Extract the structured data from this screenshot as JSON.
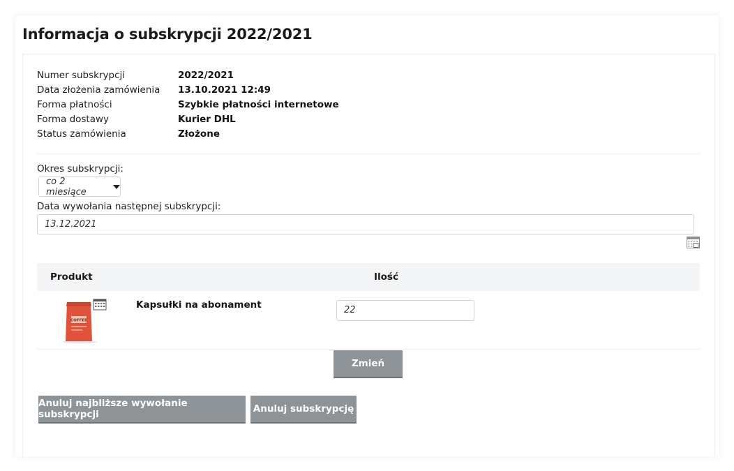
{
  "page": {
    "title": "Informacja o subskrypcji 2022/2021"
  },
  "info": {
    "rows": [
      {
        "label": "Numer subskrypcji",
        "value": "2022/2021"
      },
      {
        "label": "Data złożenia zamówienia",
        "value": "13.10.2021 12:49"
      },
      {
        "label": "Forma płatności",
        "value": "Szybkie płatności internetowe"
      },
      {
        "label": "Forma dostawy",
        "value": "Kurier DHL"
      },
      {
        "label": "Status zamówienia",
        "value": "Złożone"
      }
    ]
  },
  "period": {
    "label": "Okres subskrypcji:",
    "selected": "co 2 miesiące"
  },
  "next_date": {
    "label": "Data wywołania następnej subskrypcji:",
    "value": "13.12.2021"
  },
  "table": {
    "headers": {
      "product": "Produkt",
      "quantity": "Ilość"
    },
    "rows": [
      {
        "product_name": "Kapsułki na abonament",
        "quantity": "22",
        "image_text": "COFFEE"
      }
    ]
  },
  "buttons": {
    "change": "Zmień",
    "cancel_next": "Anuluj najbliższe wywołanie subskrypcji",
    "cancel_subscription": "Anuluj subskrypcję"
  },
  "colors": {
    "button_bg": "#8d9396",
    "table_header_bg": "#f2f4f5",
    "product_bag": "#e0523a"
  },
  "icons": {
    "calendar": "calendar-icon",
    "dropdown": "caret-down-icon",
    "product_badge": "calendar-badge-icon"
  }
}
